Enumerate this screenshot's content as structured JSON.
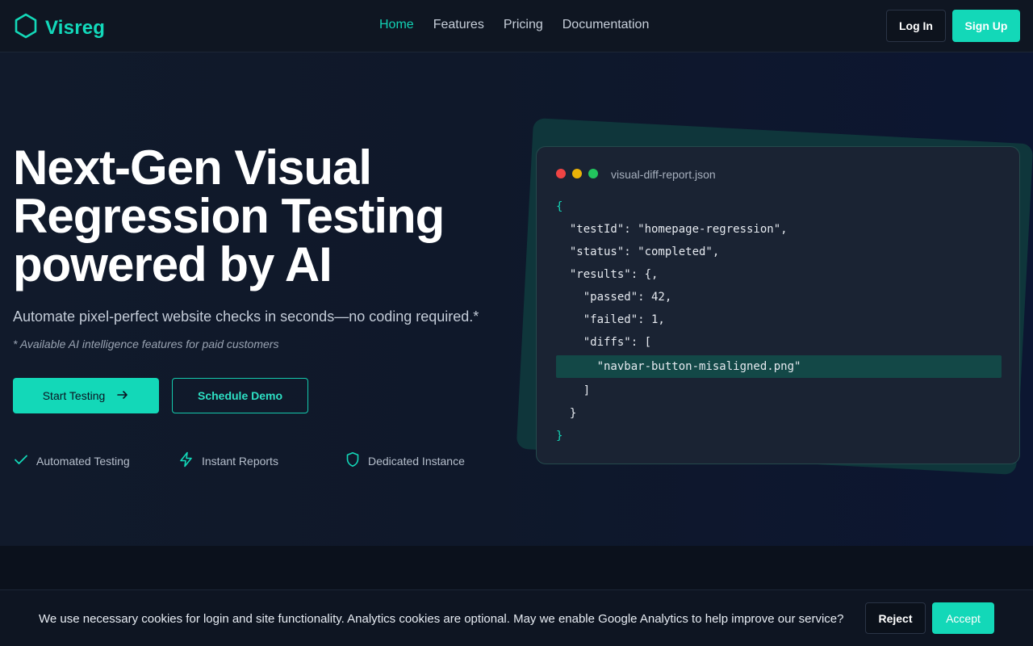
{
  "brand": {
    "name": "Visreg",
    "logo_icon": "hexagon-icon",
    "accent": "#13d8b8"
  },
  "nav": {
    "links": [
      {
        "label": "Home",
        "active": true
      },
      {
        "label": "Features",
        "active": false
      },
      {
        "label": "Pricing",
        "active": false
      },
      {
        "label": "Documentation",
        "active": false
      }
    ],
    "login_label": "Log In",
    "signup_label": "Sign Up"
  },
  "hero": {
    "title_line1": "Next-Gen Visual",
    "title_line2": "Regression Testing",
    "title_line3": "powered by AI",
    "subtitle": "Automate pixel-perfect website checks in seconds—no coding required.*",
    "note": "* Available AI intelligence features for paid customers",
    "start_label": "Start Testing",
    "start_icon": "arrow-right-icon",
    "demo_label": "Schedule Demo",
    "features": [
      {
        "label": "Automated Testing",
        "icon": "check-icon"
      },
      {
        "label": "Instant Reports",
        "icon": "lightning-icon"
      },
      {
        "label": "Dedicated Instance",
        "icon": "shield-icon"
      }
    ]
  },
  "code_card": {
    "filename": "visual-diff-report.json",
    "window_dot_colors": [
      "#ef4444",
      "#eab308",
      "#22c55e"
    ],
    "lines": [
      "{",
      "  \"testId\": \"homepage-regression\",",
      "  \"status\": \"completed\",",
      "  \"results\": {,",
      "    \"passed\": 42,",
      "    \"failed\": 1,",
      "    \"diffs\": [",
      "      \"navbar-button-misaligned.png\"",
      "    ]",
      "  }",
      "}"
    ],
    "highlighted_line": 7
  },
  "cookie": {
    "text": "We use necessary cookies for login and site functionality. Analytics cookies are optional. May we enable Google Analytics to help improve our service?",
    "reject_label": "Reject",
    "accept_label": "Accept"
  }
}
